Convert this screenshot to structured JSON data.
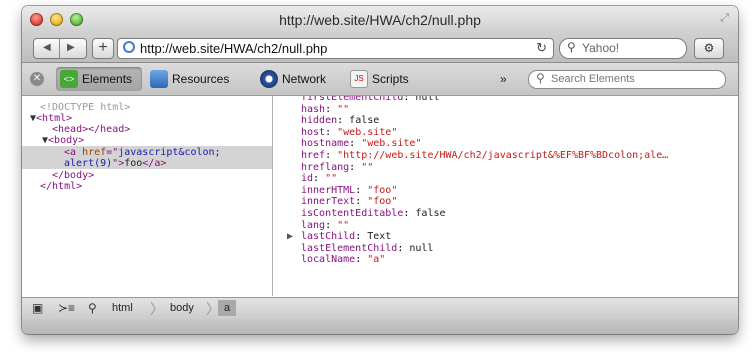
{
  "window": {
    "title": "http://web.site/HWA/ch2/null.php"
  },
  "address_bar": {
    "url": "http://web.site/HWA/ch2/null.php",
    "search_placeholder": "Yahoo!"
  },
  "inspector": {
    "tabs": [
      {
        "label": "Elements",
        "icon": "elements-icon",
        "selected": true
      },
      {
        "label": "Resources",
        "icon": "resources-icon",
        "selected": false
      },
      {
        "label": "Network",
        "icon": "network-icon",
        "selected": false
      },
      {
        "label": "Scripts",
        "icon": "scripts-icon",
        "selected": false
      }
    ],
    "more": "»",
    "search_placeholder": "Search Elements"
  },
  "dom_tree": {
    "doctype": "<!DOCTYPE html>",
    "html_open": "<html>",
    "head": "<head></head>",
    "body_open": "<body>",
    "a_open": "<a",
    "a_attr": "href",
    "a_eq": "=\"",
    "a_val_1": "javascript&colon;",
    "a_val_2": "alert(9)",
    "a_close_quote": "\">",
    "a_text": "foo",
    "a_end": "</a>",
    "body_close": "</body>",
    "html_close": "</html>"
  },
  "properties": [
    {
      "key": "firstElementChild",
      "value": "null",
      "kind": "lit"
    },
    {
      "key": "hash",
      "value": "\"\"",
      "kind": "str"
    },
    {
      "key": "hidden",
      "value": "false",
      "kind": "lit"
    },
    {
      "key": "host",
      "value": "\"web.site\"",
      "kind": "str"
    },
    {
      "key": "hostname",
      "value": "\"web.site\"",
      "kind": "str"
    },
    {
      "key": "href",
      "value": "\"http://web.site/HWA/ch2/javascript&%EF%BF%BDcolon;ale…",
      "kind": "str"
    },
    {
      "key": "hreflang",
      "value": "\"\"",
      "kind": "str"
    },
    {
      "key": "id",
      "value": "\"\"",
      "kind": "str"
    },
    {
      "key": "innerHTML",
      "value": "\"foo\"",
      "kind": "str"
    },
    {
      "key": "innerText",
      "value": "\"foo\"",
      "kind": "str"
    },
    {
      "key": "isContentEditable",
      "value": "false",
      "kind": "lit"
    },
    {
      "key": "lang",
      "value": "\"\"",
      "kind": "str"
    },
    {
      "key": "lastChild",
      "value": "Text",
      "kind": "lit",
      "expandable": true
    },
    {
      "key": "lastElementChild",
      "value": "null",
      "kind": "lit"
    },
    {
      "key": "localName",
      "value": "\"a\"",
      "kind": "str"
    }
  ],
  "breadcrumbs": [
    "html",
    "body",
    "a"
  ]
}
